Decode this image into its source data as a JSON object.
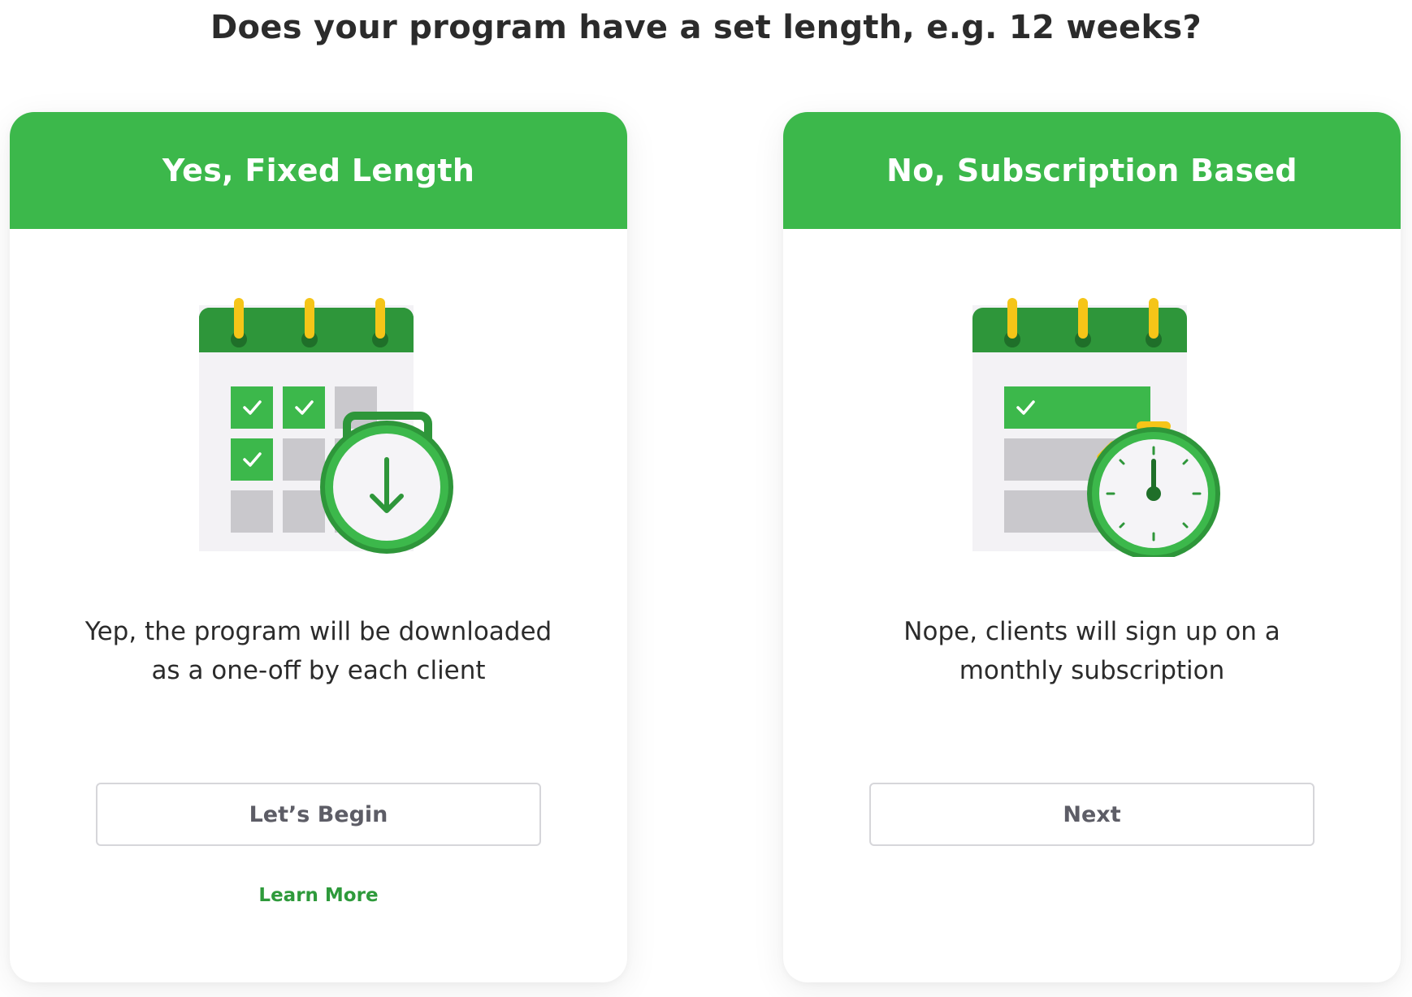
{
  "question": {
    "title": "Does your program have a set length, e.g. 12 weeks?"
  },
  "options": [
    {
      "header": "Yes, Fixed Length",
      "description": "Yep, the program will be downloaded as a one-off by each client",
      "button_label": "Let’s Begin",
      "link_label": "Learn More",
      "illustration_icons": [
        "calendar-icon",
        "download-timer-icon"
      ]
    },
    {
      "header": "No, Subscription Based",
      "description": "Nope, clients will sign up on a monthly subscription",
      "button_label": "Next",
      "illustration_icons": [
        "calendar-icon",
        "stopwatch-icon"
      ]
    }
  ],
  "colors": {
    "brand_green": "#3cb84b",
    "dark_green": "#2e963a",
    "accent_yellow": "#f5c518",
    "tile_gray": "#c9c8cc",
    "link_green": "#2e9a3b"
  }
}
